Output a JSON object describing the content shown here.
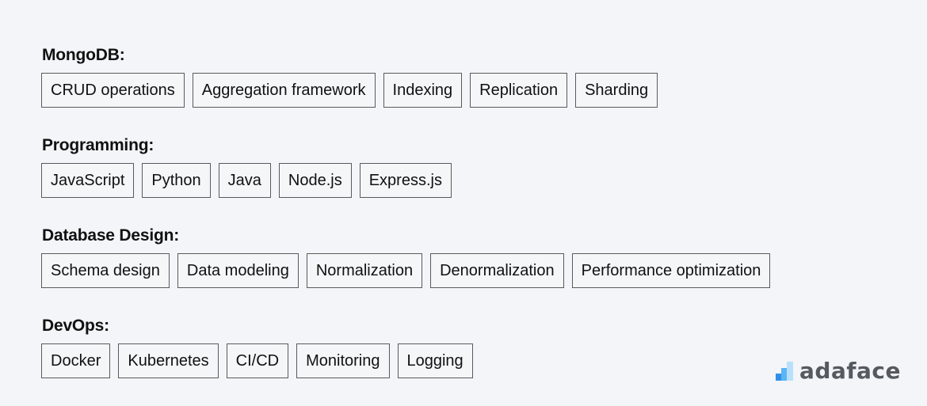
{
  "groups": [
    {
      "title": "MongoDB:",
      "tags": [
        "CRUD operations",
        "Aggregation framework",
        "Indexing",
        "Replication",
        "Sharding"
      ]
    },
    {
      "title": "Programming:",
      "tags": [
        "JavaScript",
        "Python",
        "Java",
        "Node.js",
        "Express.js"
      ]
    },
    {
      "title": "Database Design:",
      "tags": [
        "Schema design",
        "Data modeling",
        "Normalization",
        "Denormalization",
        "Performance optimization"
      ]
    },
    {
      "title": "DevOps:",
      "tags": [
        "Docker",
        "Kubernetes",
        "CI/CD",
        "Monitoring",
        "Logging"
      ]
    }
  ],
  "logo": {
    "text": "adaface",
    "icon": "bar-steps-icon",
    "colors": [
      "#2f8fe8",
      "#5ab4f5",
      "#b9e0fb"
    ]
  }
}
